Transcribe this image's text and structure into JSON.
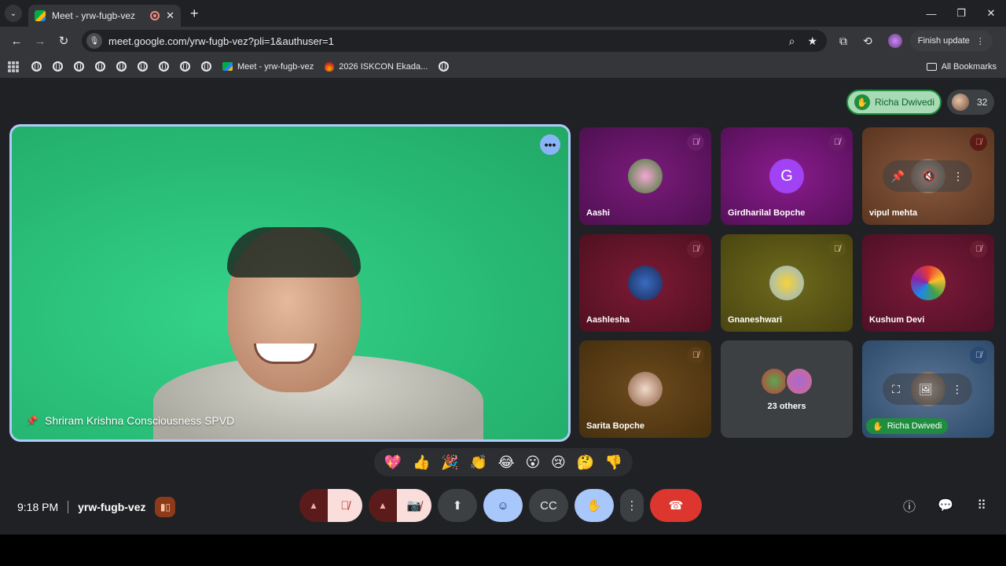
{
  "browser": {
    "tab_title": "Meet - yrw-fugb-vez",
    "url": "meet.google.com/yrw-fugb-vez?pli=1&authuser=1",
    "finish_update_label": "Finish update",
    "bookmarks": {
      "meet_label": "Meet - yrw-fugb-vez",
      "iskcon_label": "2026 ISKCON Ekada...",
      "all_bookmarks_label": "All Bookmarks"
    }
  },
  "meet": {
    "raised_hand_chip": "Richa Dwivedi",
    "participant_count": "32",
    "main_speaker": "Shriram Krishna Consciousness SPVD",
    "tiles": [
      {
        "name": "Aashi"
      },
      {
        "name": "Girdharilal Bopche",
        "initial": "G"
      },
      {
        "name": "vipul mehta"
      },
      {
        "name": "Aashlesha"
      },
      {
        "name": "Gnaneshwari"
      },
      {
        "name": "Kushum Devi"
      },
      {
        "name": "Sarita Bopche"
      },
      {
        "name": "23 others"
      },
      {
        "name": "Richa Dwivedi"
      }
    ],
    "reactions": [
      "💖",
      "👍",
      "🎉",
      "👏",
      "😂",
      "😮",
      "😢",
      "🤔",
      "👎"
    ],
    "time": "9:18 PM",
    "meeting_code": "yrw-fugb-vez"
  },
  "colors": {
    "accent_blue": "#a8c7fa",
    "mic_off_red": "#f9dedc",
    "end_call_red": "#dc362e",
    "raise_hand_green": "#1e8e3e"
  }
}
